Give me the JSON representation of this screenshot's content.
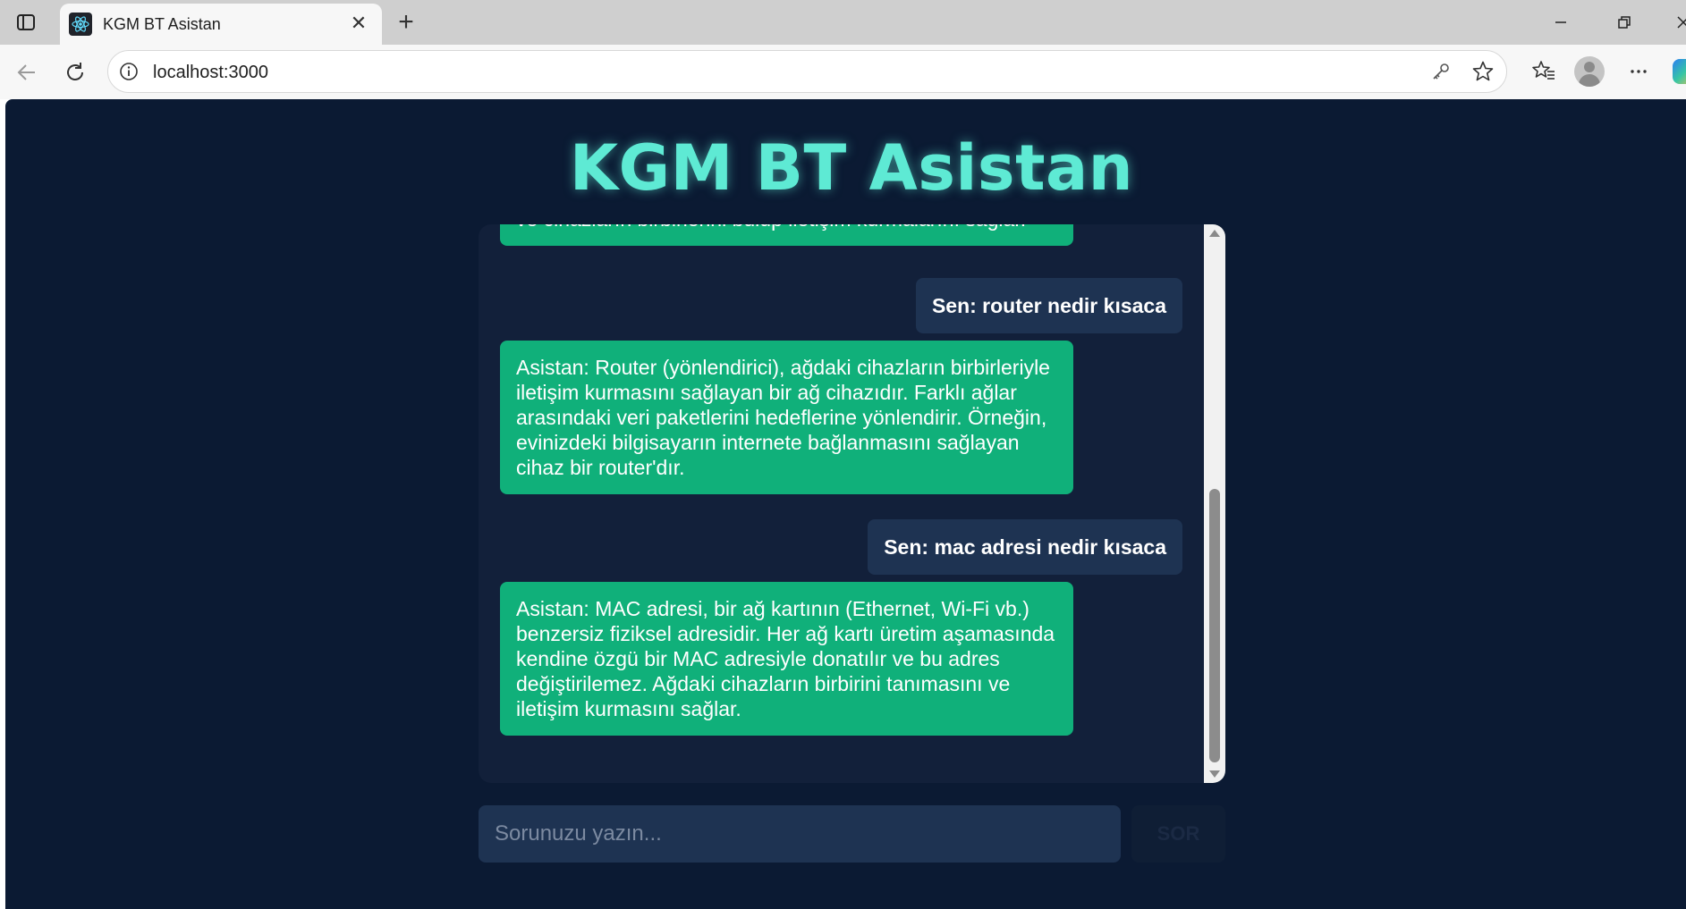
{
  "browser": {
    "tab_title": "KGM BT Asistan",
    "url": "localhost:3000",
    "icons": {
      "tab_actions": "tab-actions-icon",
      "favicon": "react-icon",
      "close": "close-icon",
      "new_tab": "plus-icon",
      "back": "back-arrow-icon",
      "reload": "reload-icon",
      "info": "info-icon",
      "password": "key-icon",
      "favorite": "star-icon",
      "favorites": "favorites-icon",
      "profile": "profile-icon",
      "more": "more-icon",
      "copilot": "copilot-icon"
    },
    "tab_close_glyph": "✕",
    "new_tab_glyph": "+"
  },
  "app": {
    "title": "KGM BT Asistan",
    "colors": {
      "background": "#0b1a33",
      "title": "#5eead4",
      "assistant_bubble": "#10b07a",
      "user_bubble": "#1e3352"
    },
    "messages": [
      {
        "role": "assistant",
        "text": "ve cihazların birbirlerini bulup iletişim kurmalarını sağlar."
      },
      {
        "role": "user",
        "text": "Sen: router nedir kısaca"
      },
      {
        "role": "assistant",
        "text": "Asistan: Router (yönlendirici), ağdaki cihazların birbirleriyle iletişim kurmasını sağlayan bir ağ cihazıdır. Farklı ağlar arasındaki veri paketlerini hedeflerine yönlendirir. Örneğin, evinizdeki bilgisayarın internete bağlanmasını sağlayan cihaz bir router'dır."
      },
      {
        "role": "user",
        "text": "Sen: mac adresi nedir kısaca"
      },
      {
        "role": "assistant",
        "text": "Asistan: MAC adresi, bir ağ kartının (Ethernet, Wi-Fi vb.) benzersiz fiziksel adresidir. Her ağ kartı üretim aşamasında kendine özgü bir MAC adresiyle donatılır ve bu adres değiştirilemez. Ağdaki cihazların birbirini tanımasını ve iletişim kurmasını sağlar."
      }
    ],
    "input": {
      "placeholder": "Sorunuzu yazın...",
      "value": ""
    },
    "send_label": "SOR"
  }
}
